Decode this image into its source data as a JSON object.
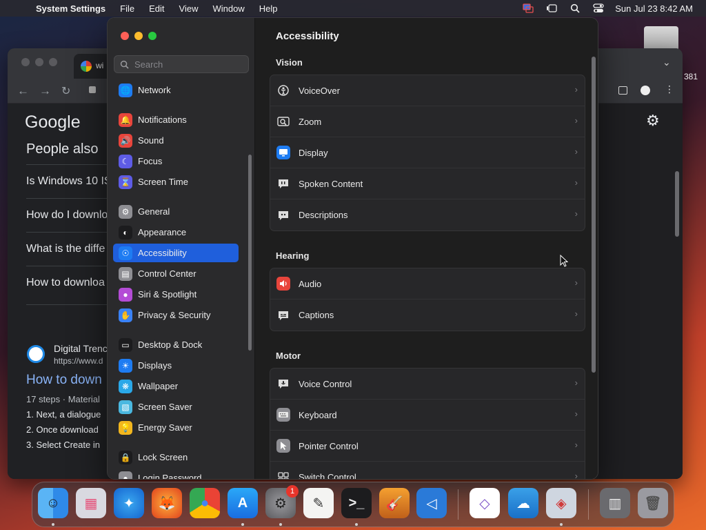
{
  "menubar": {
    "apple_glyph": "",
    "app_name": "System Settings",
    "menus": [
      "File",
      "Edit",
      "View",
      "Window",
      "Help"
    ],
    "clock": "Sun Jul 23  8:42 AM",
    "icons": [
      "screen-mirror-icon",
      "stage-manager-icon",
      "spotlight-search-icon",
      "control-center-icon"
    ]
  },
  "browser": {
    "tab_title": "wi",
    "logo": "Google",
    "heading": "People also",
    "questions": [
      "Is Windows 10 IS",
      "How do I downlo",
      "What is the diffe",
      "How to downloa"
    ],
    "source_name": "Digital Trenc",
    "source_url": "https://www.d",
    "result_title": "How to down",
    "result_meta": "17 steps · Material",
    "steps": [
      "1.  Next, a dialogue",
      "2.  Once download",
      "3.  Select Create in"
    ],
    "side_number": "381"
  },
  "settings": {
    "search_placeholder": "Search",
    "sidebar_items": [
      {
        "label": "Network",
        "color": "#1e7cf2"
      },
      {
        "label": "Notifications",
        "color": "#e8453c"
      },
      {
        "label": "Sound",
        "color": "#e8453c"
      },
      {
        "label": "Focus",
        "color": "#5e5ce6"
      },
      {
        "label": "Screen Time",
        "color": "#5e5ce6"
      },
      {
        "label": "General",
        "color": "#8e8e93"
      },
      {
        "label": "Appearance",
        "color": "#1c1c1e"
      },
      {
        "label": "Accessibility",
        "color": "#1e7cf2"
      },
      {
        "label": "Control Center",
        "color": "#8e8e93"
      },
      {
        "label": "Siri & Spotlight",
        "color": "#b44cd6"
      },
      {
        "label": "Privacy & Security",
        "color": "#3a82f6"
      },
      {
        "label": "Desktop & Dock",
        "color": "#1c1c1e"
      },
      {
        "label": "Displays",
        "color": "#1e7cf2"
      },
      {
        "label": "Wallpaper",
        "color": "#2aa8e8"
      },
      {
        "label": "Screen Saver",
        "color": "#4ab8e0"
      },
      {
        "label": "Energy Saver",
        "color": "#f2b61e"
      },
      {
        "label": "Lock Screen",
        "color": "#1c1c1e"
      },
      {
        "label": "Login Password",
        "color": "#8e8e93"
      }
    ],
    "title": "Accessibility",
    "sections": [
      {
        "label": "Vision",
        "rows": [
          "VoiceOver",
          "Zoom",
          "Display",
          "Spoken Content",
          "Descriptions"
        ]
      },
      {
        "label": "Hearing",
        "rows": [
          "Audio",
          "Captions"
        ]
      },
      {
        "label": "Motor",
        "rows": [
          "Voice Control",
          "Keyboard",
          "Pointer Control",
          "Switch Control"
        ]
      }
    ],
    "chevron": "›"
  },
  "dock": {
    "badge_count": "1",
    "apps": [
      "finder-icon",
      "launchpad-icon",
      "safari-icon",
      "firefox-icon",
      "chrome-icon",
      "app-store-icon",
      "system-settings-icon",
      "textedit-icon",
      "terminal-icon",
      "garageband-icon",
      "vscode-icon",
      "visual-studio-icon",
      "icloud-icon",
      "remote-desktop-icon",
      "downloads-stack-icon",
      "trash-icon"
    ]
  }
}
